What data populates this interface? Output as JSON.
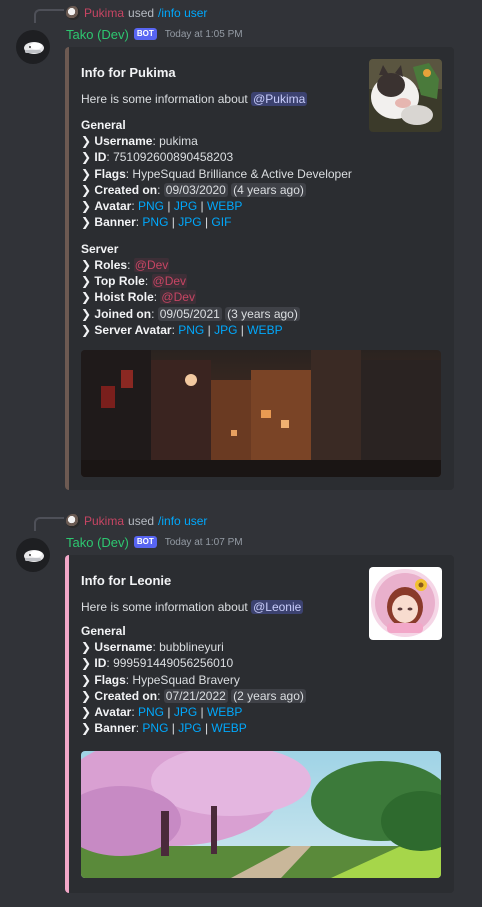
{
  "messages": [
    {
      "reply": {
        "user": "Pukima",
        "used": "used",
        "command": "/info user"
      },
      "author": {
        "name": "Tako (Dev)",
        "badge": "BOT",
        "timestamp": "Today at 1:05 PM"
      },
      "embed": {
        "accent": "#6d5a52",
        "title": "Info for Pukima",
        "desc_prefix": "Here is some information about ",
        "mention": "@Pukima",
        "general": {
          "title": "General",
          "username_label": "Username",
          "username": "pukima",
          "id_label": "ID",
          "id": "751092600890458203",
          "flags_label": "Flags",
          "flags": "HypeSquad Brilliance & Active Developer",
          "created_label": "Created on",
          "created": "09/03/2020",
          "created_rel": "(4 years ago)",
          "avatar_label": "Avatar",
          "avatar_links": [
            "PNG",
            "JPG",
            "WEBP"
          ],
          "banner_label": "Banner",
          "banner_links": [
            "PNG",
            "JPG",
            "GIF"
          ]
        },
        "server": {
          "title": "Server",
          "roles_label": "Roles",
          "roles": "@Dev",
          "top_role_label": "Top Role",
          "top_role": "@Dev",
          "hoist_role_label": "Hoist Role",
          "hoist_role": "@Dev",
          "joined_label": "Joined on",
          "joined": "09/05/2021",
          "joined_rel": "(3 years ago)",
          "server_avatar_label": "Server Avatar",
          "server_avatar_links": [
            "PNG",
            "JPG",
            "WEBP"
          ]
        }
      }
    },
    {
      "reply": {
        "user": "Pukima",
        "used": "used",
        "command": "/info user"
      },
      "author": {
        "name": "Tako (Dev)",
        "badge": "BOT",
        "timestamp": "Today at 1:07 PM"
      },
      "embed": {
        "accent": "#f2a7c8",
        "title": "Info for Leonie",
        "desc_prefix": "Here is some information about ",
        "mention": "@Leonie",
        "general": {
          "title": "General",
          "username_label": "Username",
          "username": "bubblineyuri",
          "id_label": "ID",
          "id": "999591449056256010",
          "flags_label": "Flags",
          "flags": "HypeSquad Bravery",
          "created_label": "Created on",
          "created": "07/21/2022",
          "created_rel": "(2 years ago)",
          "avatar_label": "Avatar",
          "avatar_links": [
            "PNG",
            "JPG",
            "WEBP"
          ],
          "banner_label": "Banner",
          "banner_links": [
            "PNG",
            "JPG",
            "WEBP"
          ]
        }
      }
    }
  ],
  "colors": {
    "background": "#313338",
    "embed_bg": "#2b2d31",
    "bot_name": "#2dc770",
    "bot_badge": "#5865f2",
    "link": "#00a8fc",
    "role": "#c64563"
  }
}
